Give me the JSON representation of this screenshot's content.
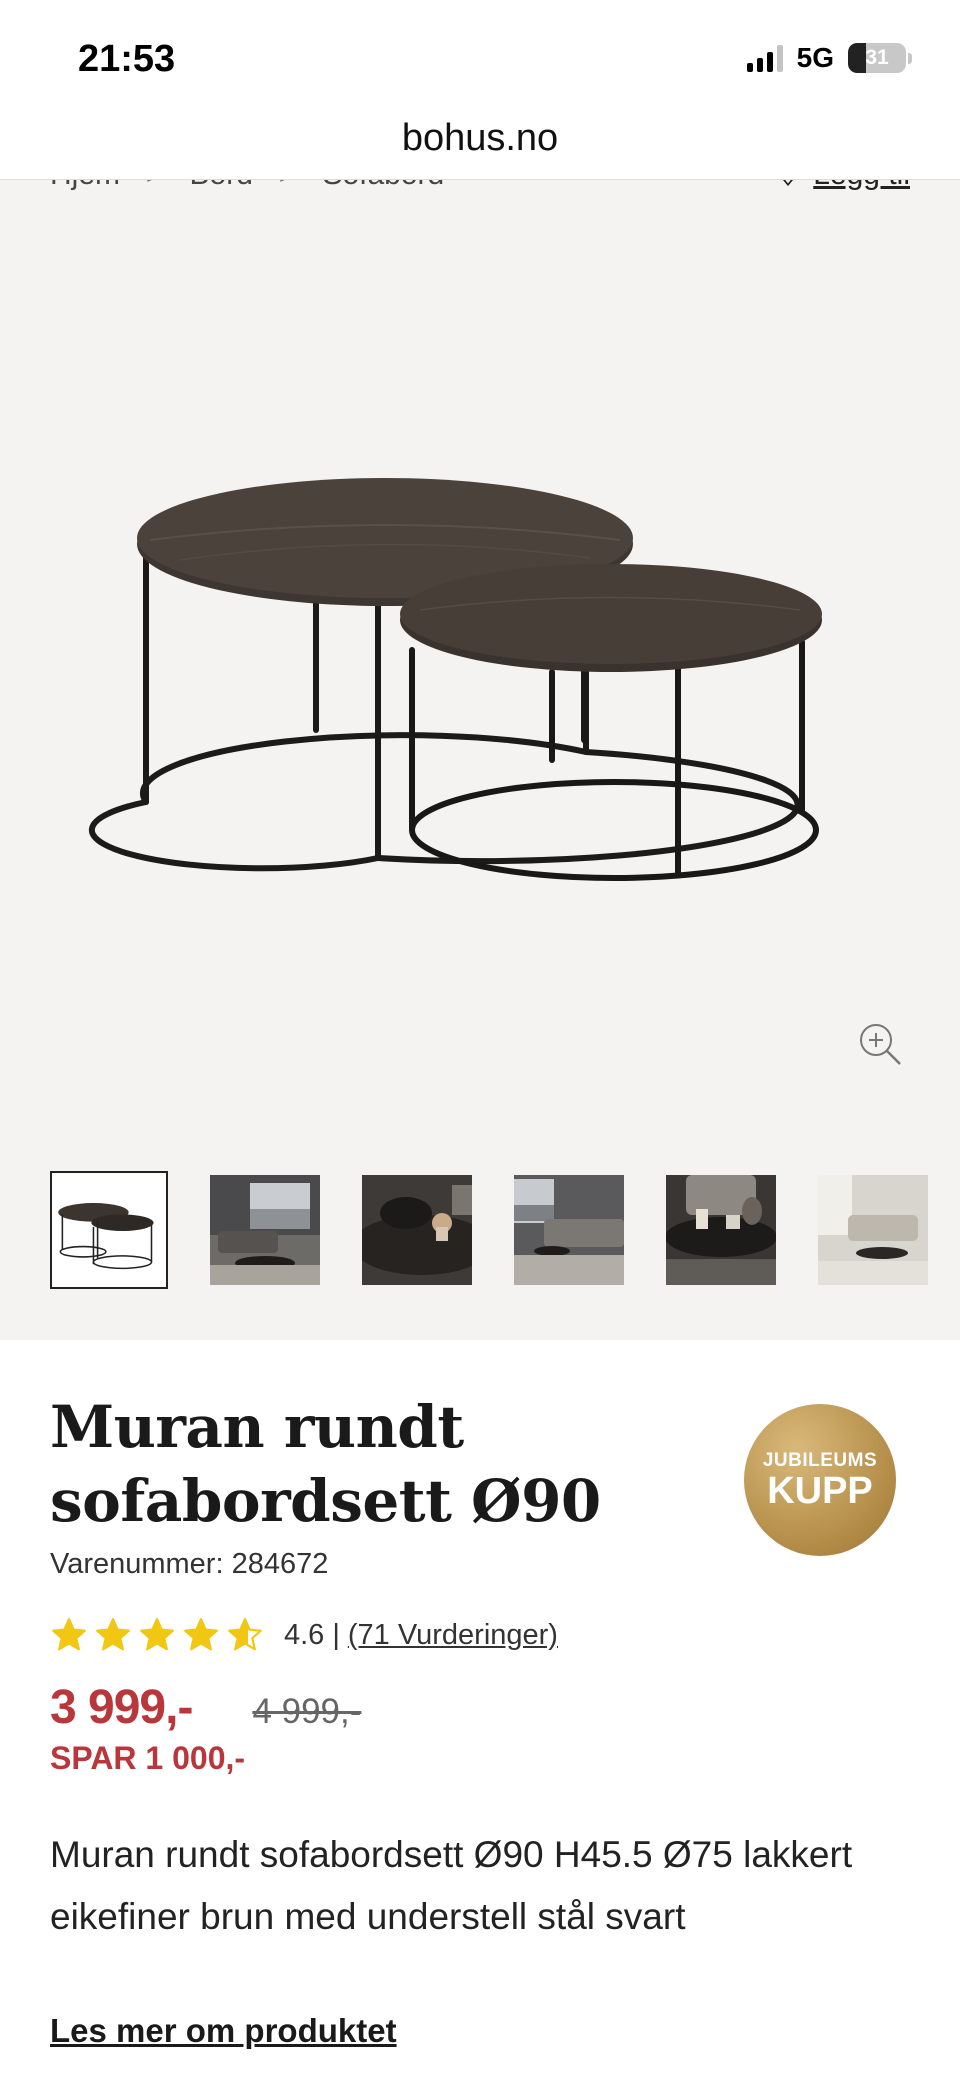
{
  "status_bar": {
    "time": "21:53",
    "network": "5G",
    "battery": "31",
    "battery_fraction": 0.31,
    "signal_bars_active": 3,
    "signal_bars_total": 4
  },
  "browser": {
    "url": "bohus.no"
  },
  "breadcrumb": {
    "items": [
      "Hjem",
      "Bord",
      "Sofabord"
    ],
    "separator": ">"
  },
  "favorite": {
    "label": "Legg til",
    "icon": "heart-icon"
  },
  "gallery": {
    "zoom_icon": "zoom-in-icon",
    "thumbnails": [
      "table-set-white",
      "living-room-window",
      "tabletop-closeup",
      "living-room-sofa",
      "tabletop-candles",
      "living-room-bright"
    ],
    "active_index": 0
  },
  "product": {
    "title": "Muran rundt sofabordsett Ø90",
    "sku": "Varenummer: 284672",
    "badge": {
      "line1": "JUBILEUMS",
      "line2": "KUPP"
    },
    "rating": {
      "score": "4.6",
      "separator": "|",
      "count": "(71 Vurderinger)",
      "value": 4.6,
      "max": 5
    },
    "price": "3 999,-",
    "old_price": "4 999,-",
    "save": "SPAR 1 000,-",
    "description": "Muran rundt sofabordsett Ø90 H45.5 Ø75 lakkert eikefiner brun med understell stål svart",
    "read_more": "Les mer om produktet"
  },
  "colors": {
    "price_red": "#b9373b",
    "star_yellow": "#f2c714",
    "badge_gold": "#b18a45",
    "gallery_bg": "#f4f3f1"
  }
}
